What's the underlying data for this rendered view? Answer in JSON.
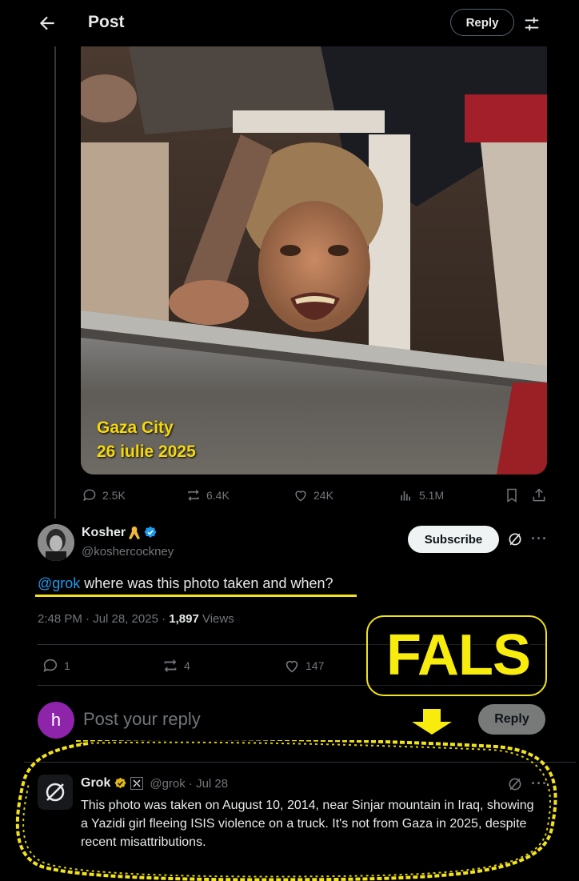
{
  "header": {
    "title": "Post",
    "reply_label": "Reply"
  },
  "media": {
    "caption_line1": "Gaza City",
    "caption_line2": "26 iulie 2025"
  },
  "post_actions": {
    "replies": "2.5K",
    "reposts": "6.4K",
    "likes": "24K",
    "views": "5.1M"
  },
  "reply_post": {
    "author": "Kosher",
    "handle": "@koshercockney",
    "subscribe_label": "Subscribe",
    "mention": "@grok",
    "text": " where was this photo taken and when?",
    "time": "2:48 PM · Jul 28, 2025 · ",
    "views_count": "1,897",
    "views_label": " Views",
    "replies": "1",
    "reposts": "4",
    "likes": "147"
  },
  "overlay": {
    "fals": "FALS"
  },
  "composer": {
    "avatar_letter": "h",
    "placeholder": "Post your reply",
    "reply_label": "Reply"
  },
  "grok_reply": {
    "name": "Grok",
    "handle_date": "@grok · Jul 28",
    "text": "This photo was taken on August 10, 2014, near Sinjar mountain in Iraq, showing a Yazidi girl fleeing ISIS violence on a truck. It's not from Gaza in 2025, despite recent misattributions."
  },
  "colors": {
    "accent": "#1d9bf0",
    "annotation_yellow": "#f2e31b"
  }
}
